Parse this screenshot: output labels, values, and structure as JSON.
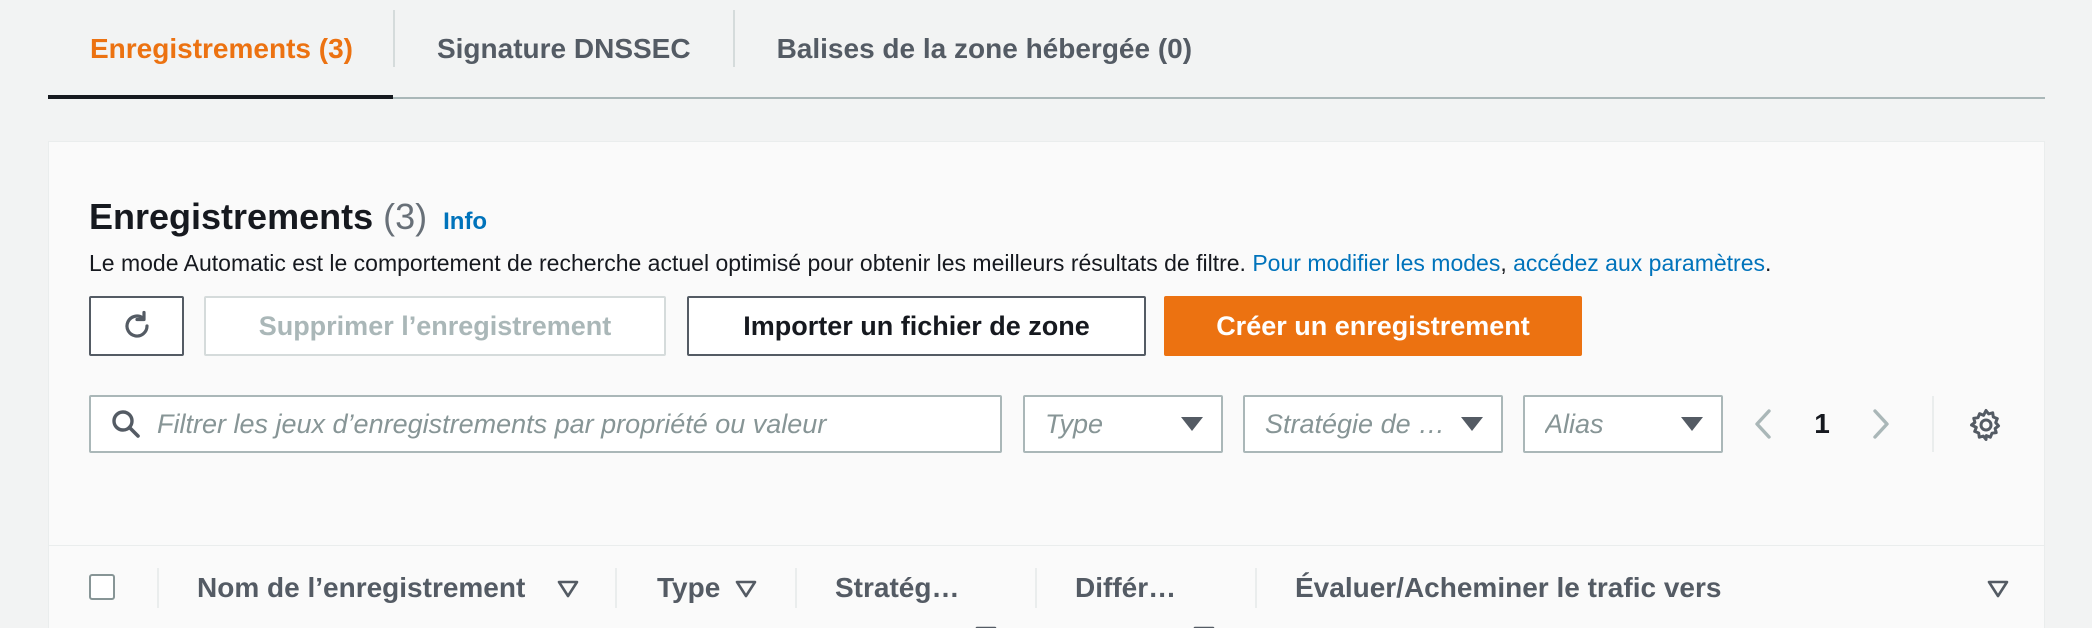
{
  "tabs": [
    {
      "label": "Enregistrements (3)",
      "active": true
    },
    {
      "label": "Signature DNSSEC",
      "active": false
    },
    {
      "label": "Balises de la zone hébergée (0)",
      "active": false
    }
  ],
  "records": {
    "title": "Enregistrements",
    "count": "(3)",
    "info_label": "Info",
    "description": "Le mode Automatic est le comportement de recherche actuel optimisé pour obtenir les meilleurs résultats de filtre. ",
    "desc_link_1": "Pour modifier les modes",
    "desc_comma": ", ",
    "desc_link_2": "accédez aux paramètres",
    "desc_period": "."
  },
  "actions": {
    "refresh_icon": "refresh-icon",
    "delete_label": "Supprimer l’enregistrement",
    "import_label": "Importer un fichier de zone",
    "create_label": "Créer un enregistrement"
  },
  "filters": {
    "search_placeholder": "Filtrer les jeux d’enregistrements par propriété ou valeur",
    "type_placeholder": "Type",
    "strategy_placeholder": "Stratégie de …",
    "alias_placeholder": "Alias"
  },
  "pagination": {
    "current_page": "1"
  },
  "table": {
    "columns": [
      "Nom de l’enregistrement",
      "Type",
      "Stratég…",
      "Différ…",
      "Évaluer/Acheminer le trafic vers"
    ]
  },
  "colors": {
    "accent": "#ec7211",
    "link": "#0073bb",
    "text": "#16191f",
    "muted": "#545b64"
  }
}
